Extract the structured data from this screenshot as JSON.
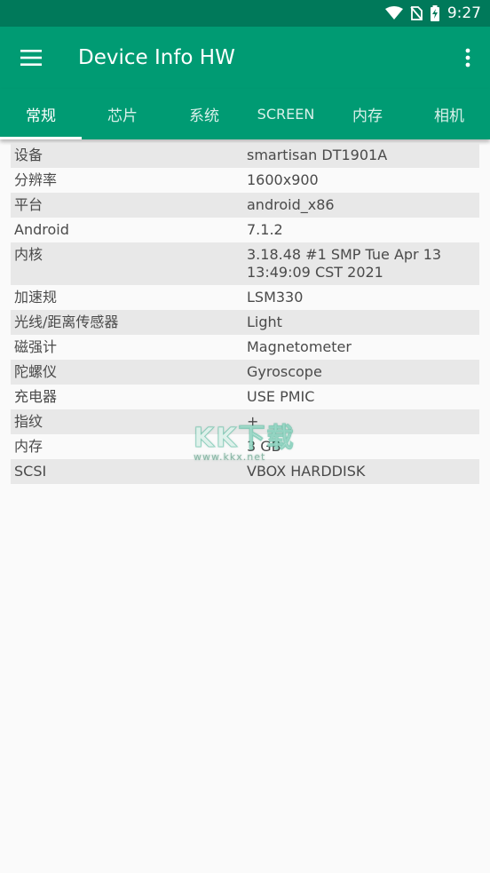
{
  "status_bar": {
    "time": "9:27",
    "icons": [
      "wifi-icon",
      "no-sim-icon",
      "battery-charging-icon"
    ]
  },
  "app_bar": {
    "title": "Device Info HW",
    "menu_icon": "hamburger-menu-icon",
    "overflow_icon": "more-vert-icon"
  },
  "tabs": [
    {
      "label": "常规",
      "active": true
    },
    {
      "label": "芯片",
      "active": false
    },
    {
      "label": "系统",
      "active": false
    },
    {
      "label": "SCREEN",
      "active": false
    },
    {
      "label": "内存",
      "active": false
    },
    {
      "label": "相机",
      "active": false
    }
  ],
  "rows": [
    {
      "key": "设备",
      "value": "smartisan DT1901A"
    },
    {
      "key": "分辨率",
      "value": "1600x900"
    },
    {
      "key": "平台",
      "value": "android_x86"
    },
    {
      "key": "Android",
      "value": "7.1.2"
    },
    {
      "key": "内核",
      "value": "3.18.48 #1 SMP Tue Apr 13 13:49:09 CST 2021"
    },
    {
      "key": "加速规",
      "value": "LSM330"
    },
    {
      "key": "光线/距离传感器",
      "value": "Light"
    },
    {
      "key": "磁强计",
      "value": "Magnetometer"
    },
    {
      "key": "陀螺仪",
      "value": "Gyroscope"
    },
    {
      "key": "充电器",
      "value": "USE PMIC"
    },
    {
      "key": "指纹",
      "value": "+"
    },
    {
      "key": "内存",
      "value": "3 GB"
    },
    {
      "key": "SCSI",
      "value": "VBOX HARDDISK"
    }
  ],
  "watermark": {
    "big": "KK下载",
    "small": "www.kkx.net"
  },
  "colors": {
    "status_bar": "#00795a",
    "app_bar": "#009b73",
    "row_odd": "#e8e8e8",
    "row_even": "#fafafa",
    "text": "#4a4a4a"
  }
}
